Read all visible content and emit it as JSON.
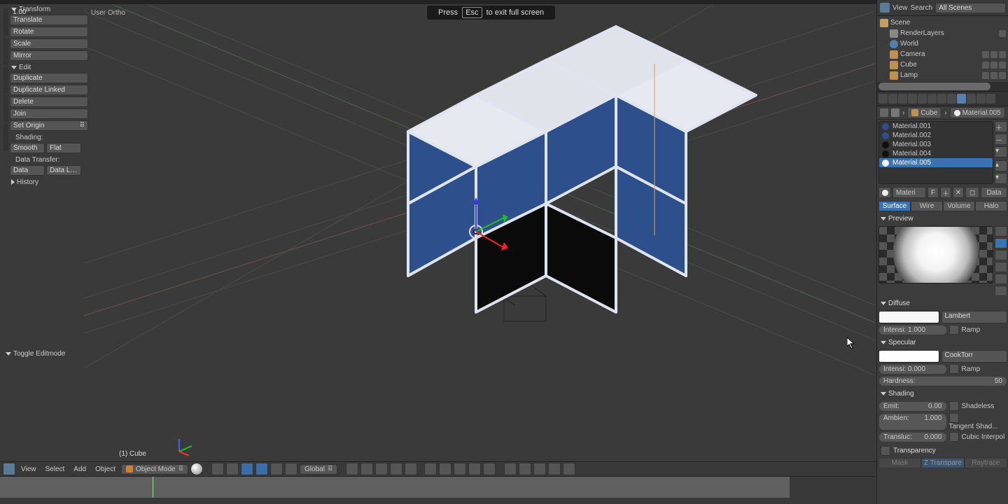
{
  "viewport": {
    "frame_label": "1.00",
    "view_label": "User Ortho",
    "fullscreen_pre": "Press",
    "fullscreen_key": "Esc",
    "fullscreen_post": "to exit full screen",
    "selected_object": "(1) Cube",
    "last_operator": "Toggle Editmode"
  },
  "tool_shelf": {
    "transform_header": "Transform",
    "translate": "Translate",
    "rotate": "Rotate",
    "scale": "Scale",
    "mirror": "Mirror",
    "edit_header": "Edit",
    "duplicate": "Duplicate",
    "duplicate_linked": "Duplicate Linked",
    "delete": "Delete",
    "join": "Join",
    "set_origin": "Set Origin",
    "shading_label": "Shading:",
    "smooth": "Smooth",
    "flat": "Flat",
    "data_transfer_label": "Data Transfer:",
    "data": "Data",
    "data_layout": "Data Layo",
    "history_header": "History"
  },
  "vp_header": {
    "view": "View",
    "select": "Select",
    "add": "Add",
    "object": "Object",
    "mode": "Object Mode",
    "orientation": "Global"
  },
  "outliner": {
    "view": "View",
    "search": "Search",
    "filter": "All Scenes",
    "scene": "Scene",
    "render_layers": "RenderLayers",
    "world": "World",
    "camera": "Camera",
    "cube": "Cube",
    "lamp": "Lamp"
  },
  "breadcrumb": {
    "obj": "Cube",
    "mat": "Material.005"
  },
  "material_slots": [
    {
      "name": "Material.001",
      "color": "#2d4f8b"
    },
    {
      "name": "Material.002",
      "color": "#2d4f8b"
    },
    {
      "name": "Material.003",
      "color": "#101010"
    },
    {
      "name": "Material.004",
      "color": "#101010"
    },
    {
      "name": "Material.005",
      "color": "#f4f4f4",
      "active": true
    }
  ],
  "mat_name_field": "Materi",
  "mat_name_f": "F",
  "mat_data": "Data",
  "shading_tabs": {
    "surface": "Surface",
    "wire": "Wire",
    "volume": "Volume",
    "halo": "Halo"
  },
  "sections": {
    "preview": "Preview",
    "diffuse": "Diffuse",
    "specular": "Specular",
    "shading": "Shading",
    "transparency": "Transparency"
  },
  "diffuse": {
    "swatch": "#f7f7f7",
    "model": "Lambert",
    "intensity_label": "Intensi:",
    "intensity_value": "1.000",
    "ramp": "Ramp"
  },
  "specular": {
    "swatch": "#ffffff",
    "model": "CookTorr",
    "intensity_label": "Intensi:",
    "intensity_value": "0.000",
    "ramp": "Ramp",
    "hardness_label": "Hardness:",
    "hardness_value": "50"
  },
  "shading_panel": {
    "emit_label": "Emit:",
    "emit_value": "0.00",
    "shadeless": "Shadeless",
    "ambient_label": "Ambien:",
    "ambient_value": "1.000",
    "tangent": "Tangent Shad...",
    "translucency_label": "Transluc:",
    "translucency_value": "0.000",
    "cubic": "Cubic Interpol"
  },
  "transparency": {
    "mask": "Mask",
    "ztransp": "Z Transpare",
    "raytrace": "Raytrace"
  }
}
